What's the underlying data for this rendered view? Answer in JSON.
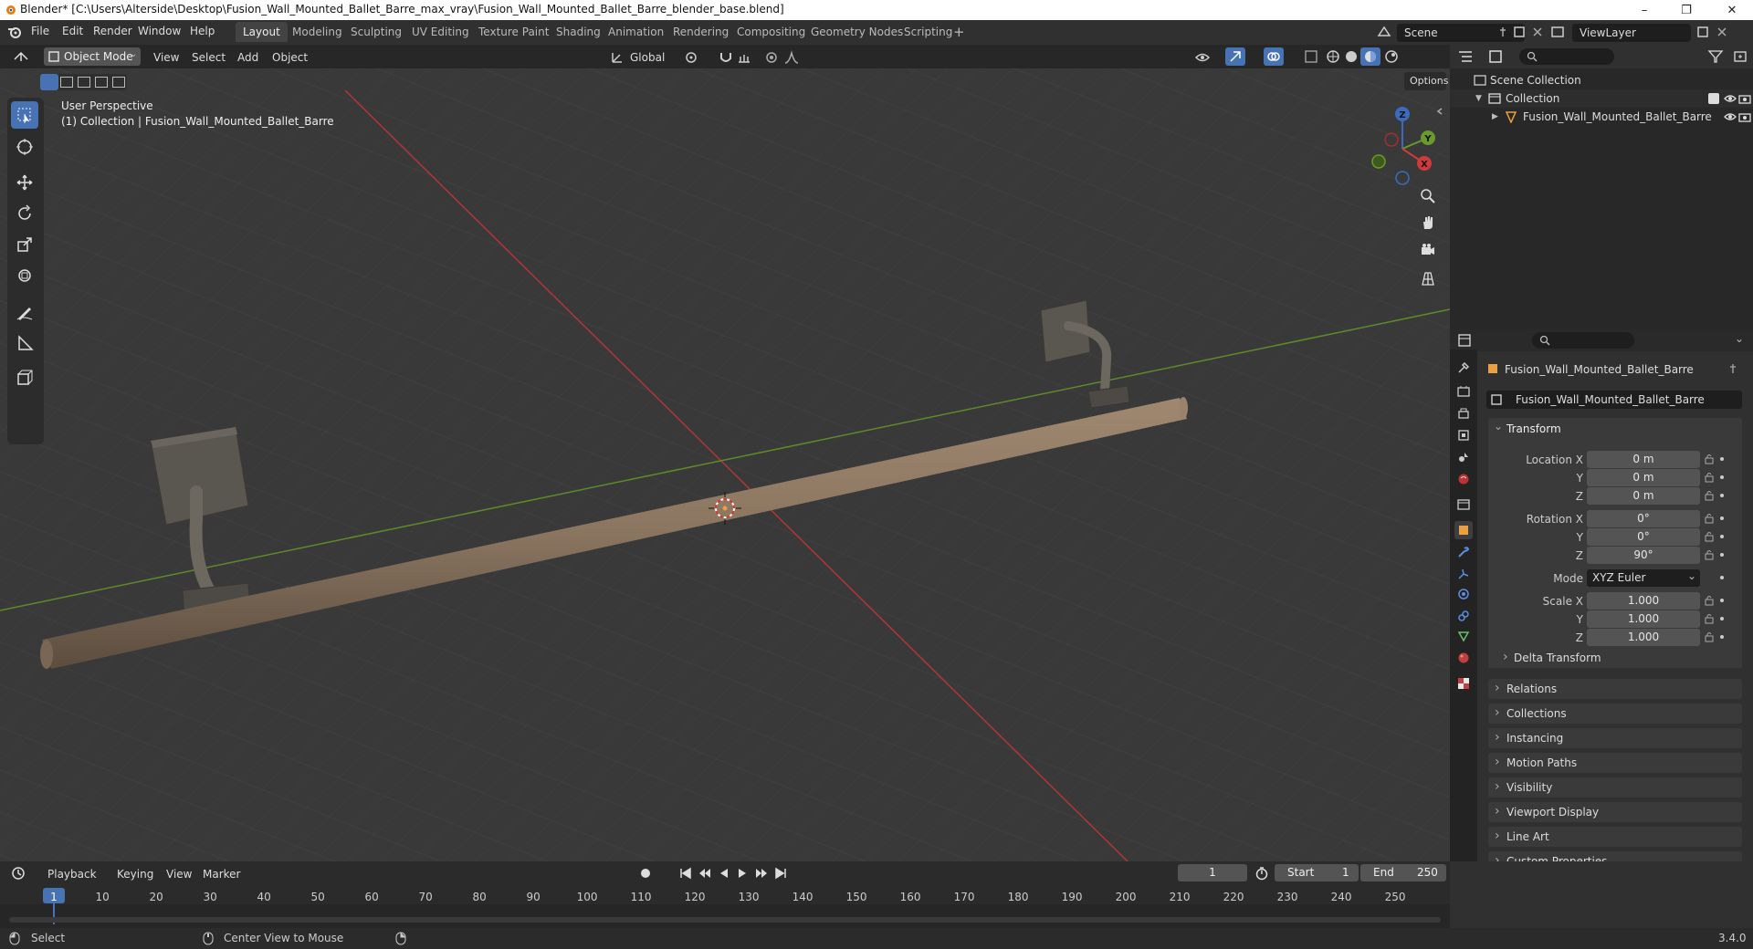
{
  "window": {
    "title": "Blender* [C:\\Users\\Alterside\\Desktop\\Fusion_Wall_Mounted_Ballet_Barre_max_vray\\Fusion_Wall_Mounted_Ballet_Barre_blender_base.blend]",
    "minimize": "–",
    "restore": "❐",
    "close": "✕"
  },
  "menus": [
    "File",
    "Edit",
    "Render",
    "Window",
    "Help"
  ],
  "workspaces": [
    "Layout",
    "Modeling",
    "Sculpting",
    "UV Editing",
    "Texture Paint",
    "Shading",
    "Animation",
    "Rendering",
    "Compositing",
    "Geometry Nodes",
    "Scripting"
  ],
  "workspace_add": "+",
  "scene": {
    "label": "Scene",
    "viewlayer": "ViewLayer"
  },
  "viewport_header": {
    "mode": "Object Mode",
    "menus": [
      "View",
      "Select",
      "Add",
      "Object"
    ],
    "transform_orientation": "Global",
    "options": "Options"
  },
  "viewport": {
    "perspective": "User Perspective",
    "collection_info": "(1) Collection | Fusion_Wall_Mounted_Ballet_Barre",
    "gizmo": {
      "x": "X",
      "y": "Y",
      "z": "Z"
    }
  },
  "outliner": {
    "scene_collection": "Scene Collection",
    "collection": "Collection",
    "object": "Fusion_Wall_Mounted_Ballet_Barre"
  },
  "properties": {
    "object_name": "Fusion_Wall_Mounted_Ballet_Barre",
    "datablock": "Fusion_Wall_Mounted_Ballet_Barre",
    "transform_title": "Transform",
    "location": {
      "label": "Location X",
      "x": "0 m",
      "y": "0 m",
      "z": "0 m"
    },
    "rotation": {
      "label": "Rotation X",
      "x": "0°",
      "y": "0°",
      "z": "90°"
    },
    "mode": {
      "label": "Mode",
      "value": "XYZ Euler"
    },
    "scale": {
      "label": "Scale X",
      "x": "1.000",
      "y": "1.000",
      "z": "1.000"
    },
    "axis_y": "Y",
    "axis_z": "Z",
    "delta_transform": "Delta Transform",
    "panels": [
      "Relations",
      "Collections",
      "Instancing",
      "Motion Paths",
      "Visibility",
      "Viewport Display",
      "Line Art",
      "Custom Properties"
    ]
  },
  "timeline": {
    "menus": [
      "Playback",
      "Keying",
      "View",
      "Marker"
    ],
    "current_frame": "1",
    "start_label": "Start",
    "start": "1",
    "end_label": "End",
    "end": "250",
    "ticks": [
      "1",
      "10",
      "20",
      "30",
      "40",
      "50",
      "60",
      "70",
      "80",
      "90",
      "100",
      "110",
      "120",
      "130",
      "140",
      "150",
      "160",
      "170",
      "180",
      "190",
      "200",
      "210",
      "220",
      "230",
      "240",
      "250"
    ]
  },
  "statusbar": {
    "select": "Select",
    "center_view": "Center View to Mouse",
    "version": "3.4.0"
  },
  "colors": {
    "active_blue": "#4772b3",
    "x_axis": "#d03a3a",
    "y_axis": "#6a9a2a",
    "object_orange": "#e8a040"
  }
}
